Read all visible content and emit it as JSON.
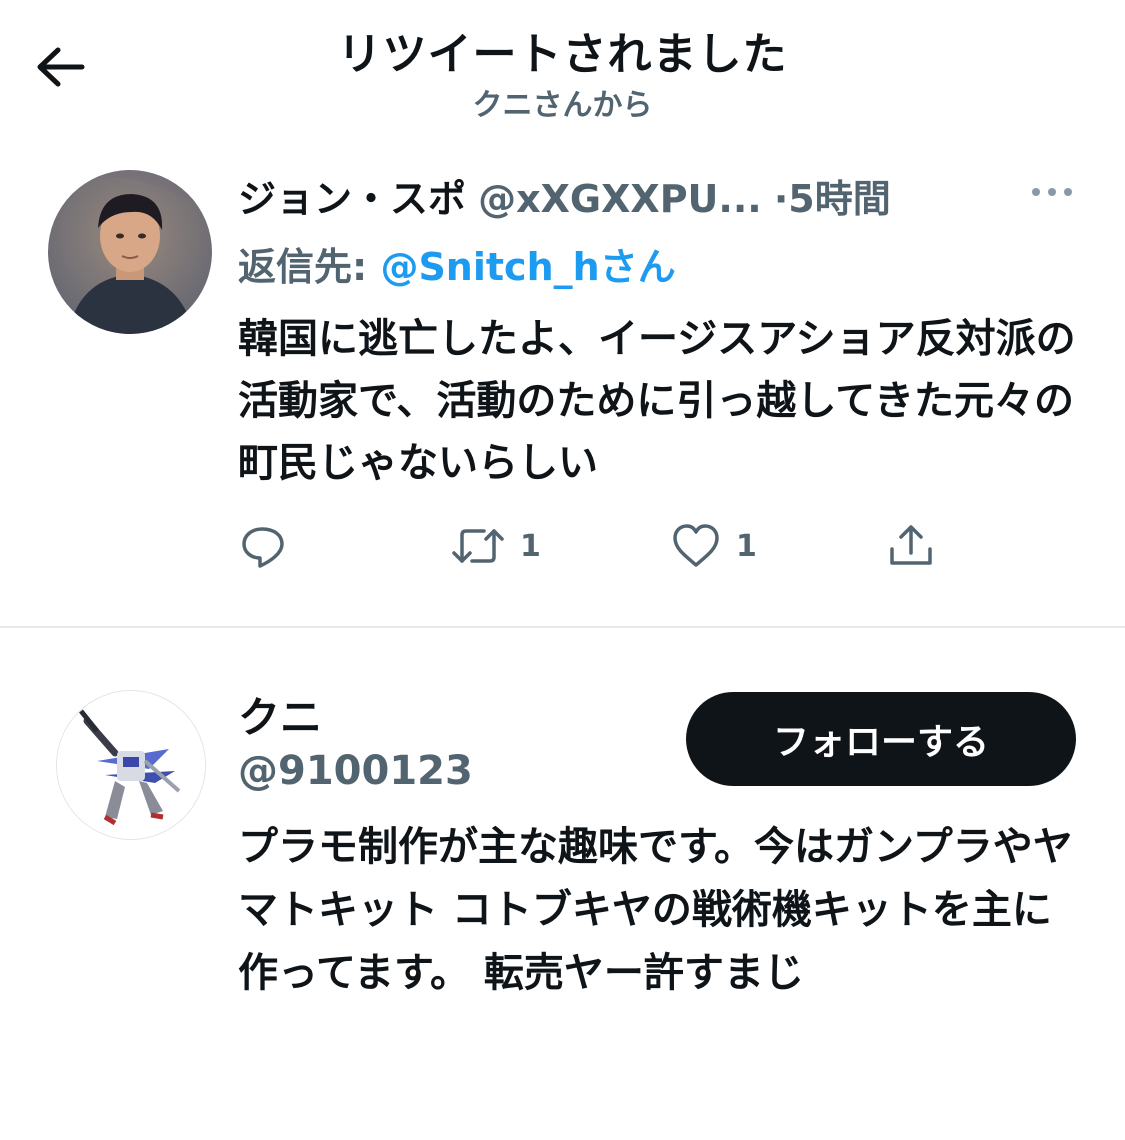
{
  "header": {
    "back_icon": "arrow-left-icon",
    "title": "リツイートされました",
    "subtitle": "クニさんから"
  },
  "tweet": {
    "author_name": "ジョン・スポ",
    "author_handle": "@xXGXXPU...",
    "separator": "·",
    "time": "5時間",
    "more_icon": "more-horizontal-icon",
    "reply_prefix": "返信先: ",
    "reply_mention": "@Snitch_h",
    "reply_suffix": "さん",
    "text": "韓国に逃亡したよ、イージスアショア反対派の活動家で、活動のために引っ越してきた元々の町民じゃないらしい",
    "actions": {
      "reply_icon": "reply-icon",
      "reply_count": "",
      "retweet_icon": "retweet-icon",
      "retweet_count": "1",
      "like_icon": "heart-icon",
      "like_count": "1",
      "share_icon": "share-icon"
    }
  },
  "profile": {
    "name": "クニ",
    "handle": "@9100123",
    "follow_label": "フォローする",
    "bio": "プラモ制作が主な趣味です。今はガンプラやヤマトキット コトブキヤの戦術機キットを主に作ってます。 転売ヤー許すまじ"
  },
  "colors": {
    "text_primary": "#0f1419",
    "text_secondary": "#536471",
    "link": "#1d9bf0",
    "follow_button_bg": "#0f1419",
    "divider": "#e7e9ea"
  }
}
